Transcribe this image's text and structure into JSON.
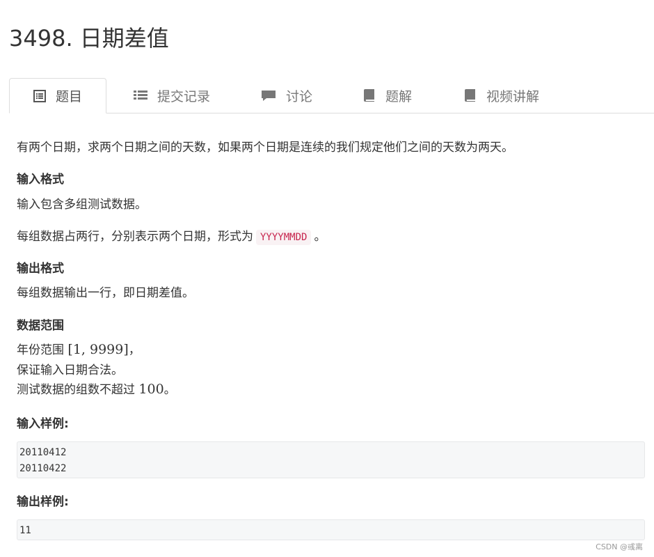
{
  "page_title": "3498. 日期差值",
  "tabs": [
    {
      "label": "题目",
      "icon": "list-alt-icon",
      "active": true
    },
    {
      "label": "提交记录",
      "icon": "list-icon",
      "active": false
    },
    {
      "label": "讨论",
      "icon": "comment-icon",
      "active": false
    },
    {
      "label": "题解",
      "icon": "book-icon",
      "active": false
    },
    {
      "label": "视频讲解",
      "icon": "book-icon",
      "active": false
    }
  ],
  "problem": {
    "description": "有两个日期，求两个日期之间的天数，如果两个日期是连续的我们规定他们之间的天数为两天。",
    "input_heading": "输入格式",
    "input_line1": "输入包含多组测试数据。",
    "input_line2_prefix": "每组数据占两行，分别表示两个日期，形式为",
    "input_line2_code": "YYYYMMDD",
    "input_line2_suffix": "。",
    "output_heading": "输出格式",
    "output_line1": "每组数据输出一行，即日期差值。",
    "range_heading": "数据范围",
    "range_line1_prefix": "年份范围",
    "range_line1_math": "[1, 9999]",
    "range_line1_suffix": "，",
    "range_line2": "保证输入日期合法。",
    "range_line3_prefix": "测试数据的组数不超过",
    "range_line3_math": "100",
    "range_line3_suffix": "。",
    "sample_input_heading": "输入样例:",
    "sample_input_lines": [
      "20110412",
      "20110422"
    ],
    "sample_output_heading": "输出样例:",
    "sample_output_lines": [
      "11"
    ]
  },
  "watermark": "CSDN @彧离"
}
